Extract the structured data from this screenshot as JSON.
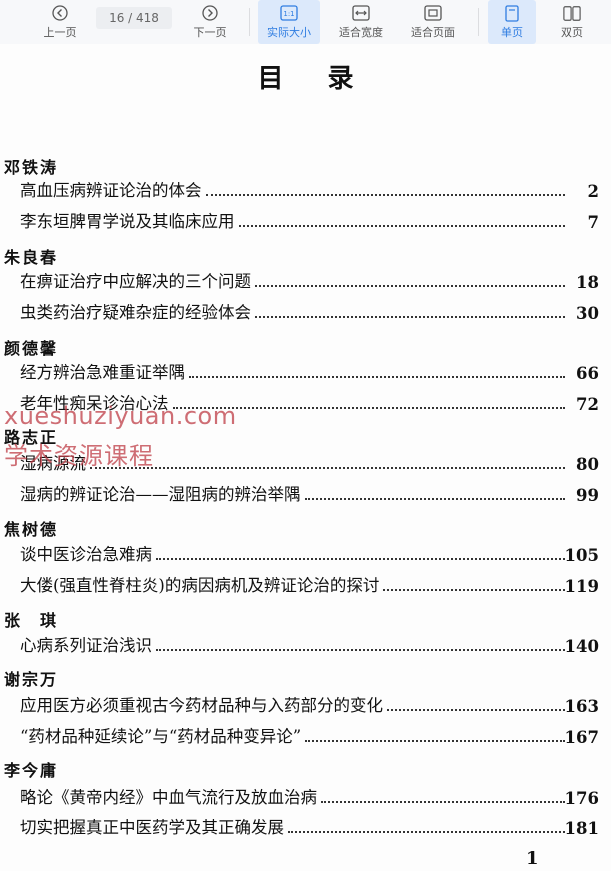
{
  "toolbar": {
    "prev_label": "上一页",
    "page_indicator": "16 / 418",
    "next_label": "下一页",
    "actual_size_label": "实际大小",
    "actual_size_icon_text": "1:1",
    "fit_width_label": "适合宽度",
    "fit_page_label": "适合页面",
    "single_page_label": "单页",
    "double_page_label": "双页",
    "accent_color": "#2f7de1"
  },
  "document": {
    "title": "目录",
    "sections": [
      {
        "author": "邓铁涛",
        "entries": [
          {
            "title": "高血压病辨证论治的体会",
            "page": "2"
          },
          {
            "title": "李东垣脾胃学说及其临床应用",
            "page": "7"
          }
        ]
      },
      {
        "author": "朱良春",
        "entries": [
          {
            "title": "在痹证治疗中应解决的三个问题",
            "page": "18"
          },
          {
            "title": "虫类药治疗疑难杂症的经验体会",
            "page": "30"
          }
        ]
      },
      {
        "author": "颜德馨",
        "entries": [
          {
            "title": "经方辨治急难重证举隅",
            "page": "66"
          },
          {
            "title": "老年性痴呆诊治心法",
            "page": "72"
          }
        ]
      },
      {
        "author": "路志正",
        "entries": [
          {
            "title": "湿病源流",
            "page": "80"
          },
          {
            "title": "湿病的辨证论治——湿阻病的辨治举隅",
            "page": "99"
          }
        ]
      },
      {
        "author": "焦树德",
        "entries": [
          {
            "title": "谈中医诊治急难病",
            "page": "105"
          },
          {
            "title": "大偻(强直性脊柱炎)的病因病机及辨证论治的探讨",
            "page": "119"
          }
        ]
      },
      {
        "author": "张　琪",
        "entries": [
          {
            "title": "心病系列证治浅识",
            "page": "140"
          }
        ]
      },
      {
        "author": "谢宗万",
        "entries": [
          {
            "title": "应用医方必须重视古今药材品种与入药部分的变化",
            "page": "163"
          },
          {
            "title": "“药材品种延续论”与“药材品种变异论”",
            "page": "167"
          }
        ]
      },
      {
        "author": "李今庸",
        "entries": [
          {
            "title": "略论《黄帝内经》中血气流行及放血治病",
            "page": "176"
          },
          {
            "title": "切实把握真正中医药学及其正确发展",
            "page": "181"
          }
        ]
      }
    ],
    "page_number": "1"
  },
  "watermark": {
    "line1": "xueshuziyuan.com",
    "line2": "学术资源课程"
  }
}
